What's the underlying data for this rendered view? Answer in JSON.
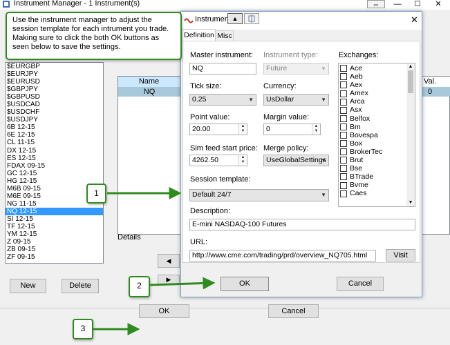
{
  "main_window": {
    "title": "Instrument Manager - 1 Instrument(s)",
    "instruments": [
      "$EURGBP",
      "$EURJPY",
      "$EURUSD",
      "$GBPJPY",
      "$GBPUSD",
      "$USDCAD",
      "$USDCHF",
      "$USDJPY",
      "6B 12-15",
      "6E 12-15",
      "CL 11-15",
      "DX 12-15",
      "ES 12-15",
      "FDAX 09-15",
      "GC 12-15",
      "HG 12-15",
      "M6B 09-15",
      "M6E 09-15",
      "NG 11-15",
      "NQ 12-15",
      "SI 12-15",
      "TF 12-15",
      "YM 12-15",
      "Z 09-15",
      "ZB 09-15",
      "ZF 09-15"
    ],
    "selected_instrument": "NQ 12-15",
    "grid_headers": {
      "name": "Name",
      "val": "Val."
    },
    "grid_row": {
      "name": "NQ",
      "val": "0"
    },
    "details_label": "Details",
    "new_label": "New",
    "delete_label": "Delete",
    "ok_label": "OK",
    "cancel_label": "Cancel",
    "nav_prev": "◀",
    "nav_next": "▶"
  },
  "dialog": {
    "title": "Instrumen",
    "tabs": [
      "Definition",
      "Misc"
    ],
    "active_tab": "Definition",
    "master_instrument_label": "Master instrument:",
    "master_instrument_value": "NQ",
    "instrument_type_label": "Instrument type:",
    "instrument_type_value": "Future",
    "tick_size_label": "Tick size:",
    "tick_size_value": "0.25",
    "currency_label": "Currency:",
    "currency_value": "UsDollar",
    "point_value_label": "Point value:",
    "point_value_value": "20.00",
    "margin_value_label": "Margin value:",
    "margin_value_value": "0",
    "sim_feed_label": "Sim feed start price:",
    "sim_feed_value": "4262.50",
    "merge_policy_label": "Merge policy:",
    "merge_policy_value": "UseGlobalSettings",
    "session_template_label": "Session template:",
    "session_template_value": "Default 24/7",
    "description_label": "Description:",
    "description_value": "E-mini NASDAQ-100 Futures",
    "url_label": "URL:",
    "url_value": "http://www.cme.com/trading/prd/overview_NQ705.html",
    "visit_label": "Visit",
    "exchanges_label": "Exchanges:",
    "exchanges": [
      "Ace",
      "Aeb",
      "Aex",
      "Amex",
      "Arca",
      "Asx",
      "Belfox",
      "Bm",
      "Bovespa",
      "Box",
      "BrokerTec",
      "Brut",
      "Bse",
      "BTrade",
      "Bvme",
      "Caes"
    ],
    "ok_label": "OK",
    "cancel_label": "Cancel",
    "close_glyph": "✕"
  },
  "callouts": {
    "instruction": "Use the instrument manager to adjust the session template for each intrument you trade. Making sure to click the both OK buttons as seen below to save the settings.",
    "step1": "1",
    "step2": "2",
    "step3": "3"
  },
  "window_controls": {
    "minimize": "—",
    "maximize": "☐",
    "close": "✕",
    "swap": "⇔"
  },
  "colors": {
    "accent_green": "#2e8b1e",
    "selection_blue": "#3399ff",
    "grid_header_blue": "#cce8ff"
  }
}
